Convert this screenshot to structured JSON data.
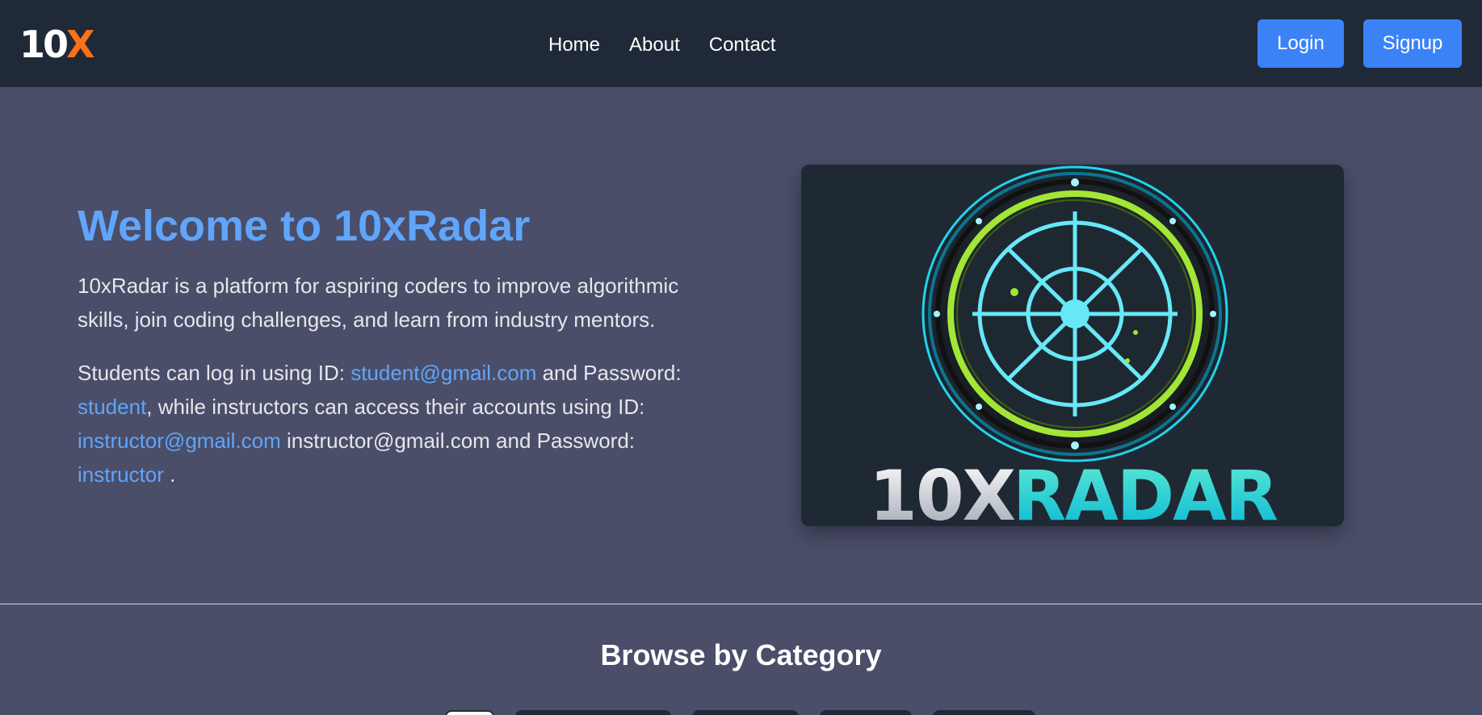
{
  "navbar": {
    "logo": {
      "part1": "10",
      "part2": "X"
    },
    "links": [
      "Home",
      "About",
      "Contact"
    ],
    "login_label": "Login",
    "signup_label": "Signup"
  },
  "hero": {
    "title": "Welcome to 10xRadar",
    "description": "10xRadar is a platform for aspiring coders to improve algorithmic skills, join coding challenges, and learn from industry mentors.",
    "credentials": {
      "t1": "Students can log in using ID: ",
      "student_email": "student@gmail.com",
      "t2": " and Password: ",
      "student_password": "student",
      "t3": ", while instructors can access their accounts using ID: ",
      "instructor_email_link": "instructor@gmail.com",
      "t4": " instructor@gmail.com and Password: ",
      "instructor_password": "instructor",
      "t5": " ."
    },
    "image": {
      "text_part1": "10X",
      "text_part2": "RADAR",
      "colors": {
        "ring_outer": "#22d3ee",
        "ring_inner": "#a3e635",
        "accent": "#67e8f9"
      }
    }
  },
  "categories": {
    "title": "Browse by Category"
  },
  "colors": {
    "navbar_bg": "#1f2937",
    "page_bg": "#4a4e69",
    "accent": "#60a5fa",
    "button": "#3b82f6",
    "logo_accent": "#f97316"
  }
}
